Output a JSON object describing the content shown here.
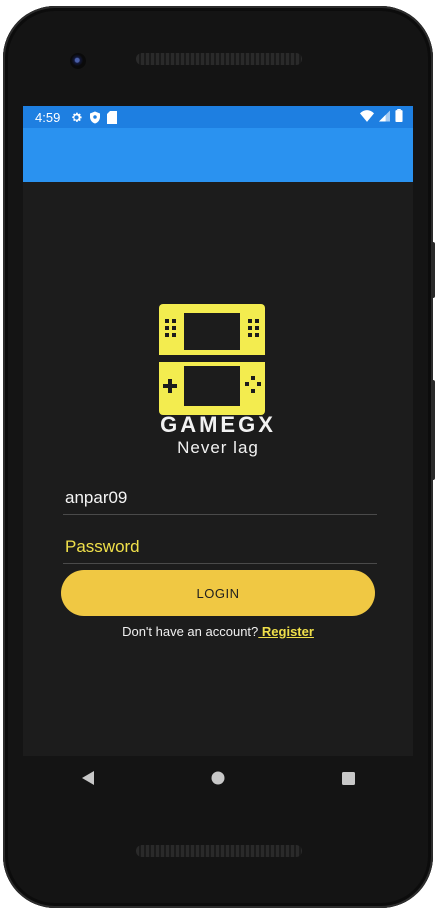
{
  "status_bar": {
    "time": "4:59",
    "icons": [
      "gear-icon",
      "shield-icon",
      "sd-card-icon",
      "wifi-icon",
      "signal-icon",
      "battery-icon"
    ]
  },
  "colors": {
    "app_bar": "#2a92f0",
    "status_bar": "#1e7fe1",
    "background": "#1c1c1c",
    "accent_yellow": "#f0c843",
    "logo_yellow": "#f3ec4f"
  },
  "brand": {
    "name": "GAMEGX",
    "tagline": "Never lag"
  },
  "form": {
    "username_value": "anpar09",
    "password_placeholder": "Password",
    "login_label": "LOGIN",
    "signup_prompt": "Don't have an account?",
    "signup_link": " Register"
  },
  "nav_bar": {
    "buttons": [
      "back-icon",
      "home-icon",
      "recents-icon"
    ]
  }
}
